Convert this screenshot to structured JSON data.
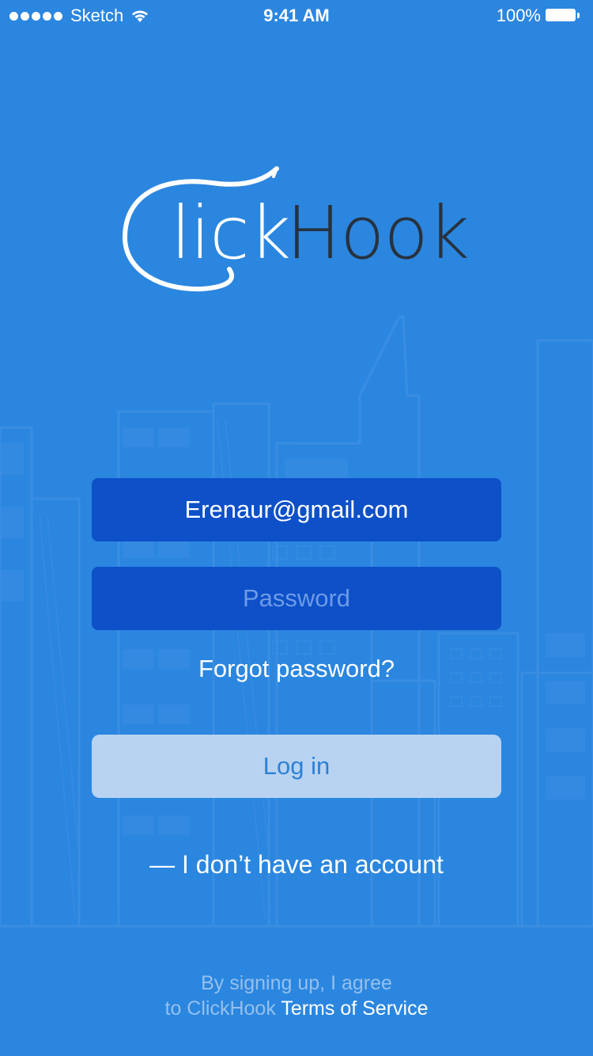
{
  "status_bar": {
    "carrier": "Sketch",
    "time": "9:41 AM",
    "battery": "100%",
    "wifi_icon": "wifi-icon",
    "battery_icon": "battery-icon"
  },
  "logo": {
    "part1": "lick",
    "part2": "Hook"
  },
  "login": {
    "email_value": "Erenaur@gmail.com",
    "password_placeholder": "Password",
    "forgot_label": "Forgot password?",
    "login_label": "Log in",
    "no_account_label": "— I don’t have an account"
  },
  "footer": {
    "line1": "By signing up, I agree",
    "line2_prefix": "to ClickHook ",
    "terms_link": "Terms of Service"
  },
  "colors": {
    "background": "#2b86df",
    "field": "#0d50c8",
    "button": "#b8d3f1",
    "button_text": "#2c80d6",
    "logo_dark": "#27323f"
  }
}
